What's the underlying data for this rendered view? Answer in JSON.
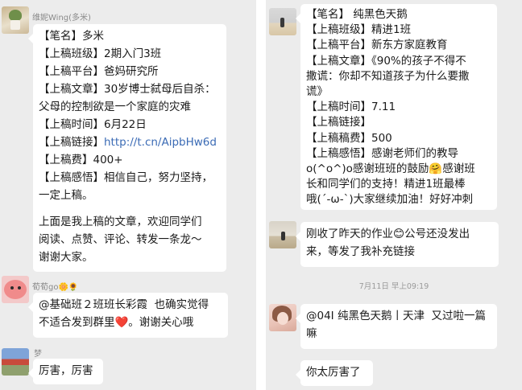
{
  "left": {
    "msg1": {
      "sender": "维妮Wing(多米)",
      "lines": [
        "【笔名】多米",
        "【上稿班级】2期入门3班",
        "【上稿平台】爸妈研究所",
        "【上稿文章】30岁博士弑母后自杀：",
        "父母的控制欲是一个家庭的灾难",
        "【上稿时间】6月22日"
      ],
      "link_label": "【上稿链接】",
      "link_url": "http://t.cn/AipbHw6d",
      "lines2": [
        "【上稿费】400+",
        "【上稿感悟】相信自己，努力坚持，",
        "一定上稿。"
      ],
      "lines3": [
        "上面是我上稿的文章，欢迎同学们",
        "阅读、点赞、评论、转发一条龙～",
        "谢谢大家。"
      ]
    },
    "msg2": {
      "sender": "荀荀go🌼🌻",
      "line1": "@基础班２班班长彩霞  也确实觉得",
      "line2": "不适合发到群里❤️。谢谢关心哦"
    },
    "msg3": {
      "sender": "梦",
      "text": "厉害，厉害"
    }
  },
  "right": {
    "msg1": {
      "lines": [
        "【笔名】 纯黑色天鹅",
        "【上稿班级】精进1班",
        "【上稿平台】新东方家庭教育",
        "【上稿文章】《90%的孩子不得不",
        "撒谎：你却不知道孩子为什么要撒",
        "谎》",
        "【上稿时间】7.11",
        "【上稿链接】",
        "【上稿稿费】500",
        "【上稿感悟】感谢老师们的教导",
        "o(^o^)o感谢班班的鼓励🤗感谢班",
        "长和同学们的支持！精进1班最棒",
        "哦(´-ω-`)大家继续加油！好好冲刺"
      ]
    },
    "msg2": {
      "line1": "刚收了昨天的作业😊公号还没发出",
      "line2": "来，等发了我补充链接"
    },
    "timestamp": "7月11日 早上09:19",
    "msg3": {
      "line1": "@04I 纯黑色天鹅丨天津  又过啦一篇",
      "line2": "嘛"
    },
    "msg4": {
      "text": "你太厉害了"
    }
  }
}
